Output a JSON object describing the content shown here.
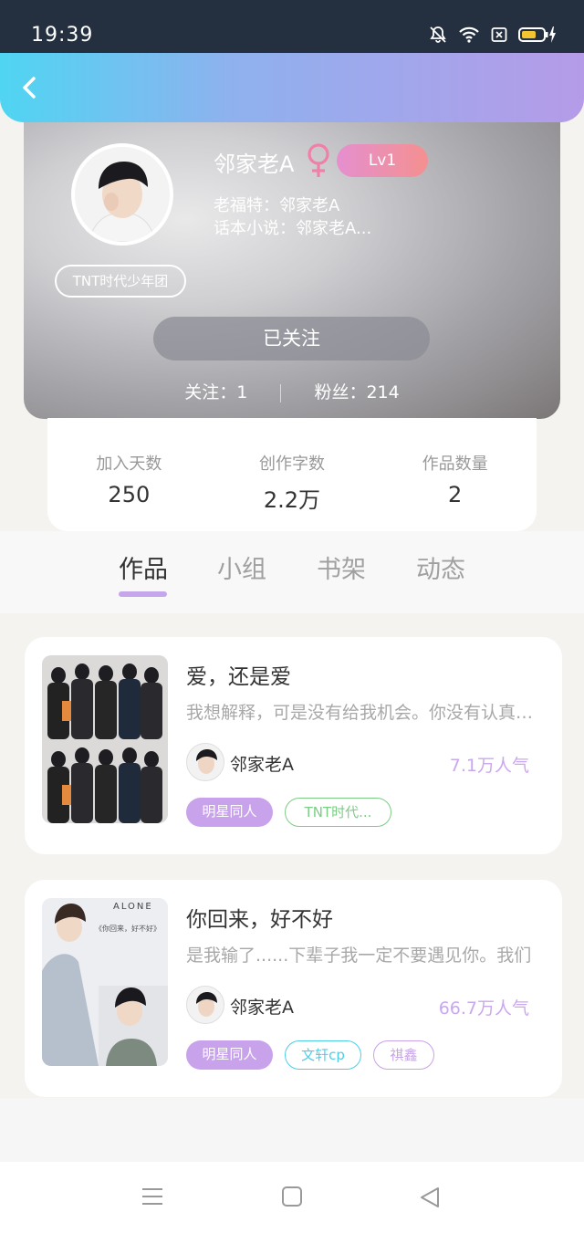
{
  "status_bar": {
    "time": "19:39"
  },
  "profile": {
    "name": "邻家老A",
    "level": "Lv1",
    "lofter": "老福特：邻家老A",
    "novel": "话本小说：邻家老A...",
    "group_tag": "TNT时代少年团",
    "follow_button": "已关注",
    "following": "关注：1",
    "fans": "粉丝：214"
  },
  "stats": [
    {
      "label": "加入天数",
      "value": "250"
    },
    {
      "label": "创作字数",
      "value": "2.2万"
    },
    {
      "label": "作品数量",
      "value": "2"
    }
  ],
  "tabs": [
    {
      "label": "作品"
    },
    {
      "label": "小组"
    },
    {
      "label": "书架"
    },
    {
      "label": "动态"
    }
  ],
  "works": [
    {
      "title": "爱，还是爱",
      "desc": "我想解释，可是没有给我机会。你没有认真听我解释",
      "author": "邻家老A",
      "popularity": "7.1万人气",
      "tags": [
        "明星同人",
        "TNT时代..."
      ]
    },
    {
      "title": "你回来，好不好",
      "desc": "是我输了......下辈子我一定不要遇见你。我们",
      "author": "邻家老A",
      "popularity": "66.7万人气",
      "tags": [
        "明星同人",
        "文轩cp",
        "祺鑫"
      ]
    }
  ],
  "cover2_text": {
    "alone": "ALONE",
    "line": "《你回来，好不好》"
  },
  "colors": {
    "accent": "#c8a2ea",
    "header_start": "#4fd5f2",
    "header_end": "#b59be8",
    "level_badge": "#e58fcf"
  }
}
